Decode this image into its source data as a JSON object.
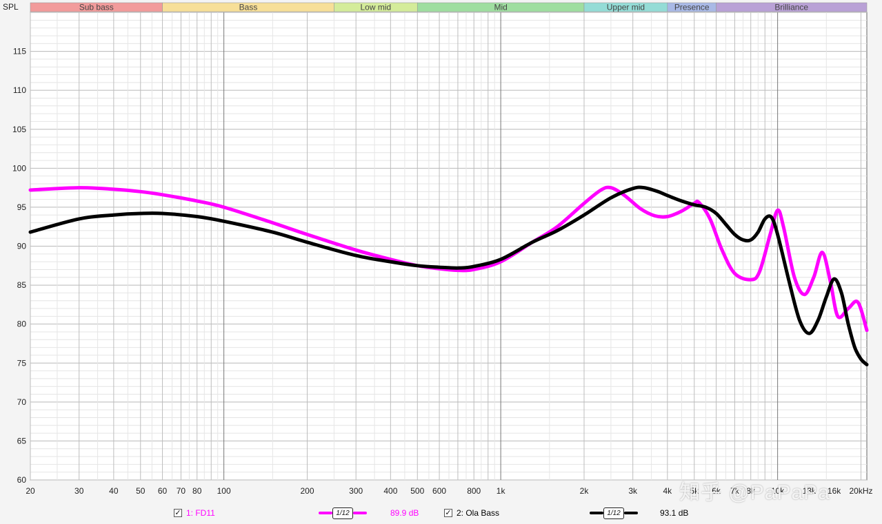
{
  "chart_data": {
    "type": "line",
    "title": "",
    "ylabel": "SPL",
    "xlabel": "",
    "x_scale": "log",
    "xlim": [
      20,
      21000
    ],
    "ylim": [
      60,
      120
    ],
    "grid": true,
    "y_ticks": [
      60,
      65,
      70,
      75,
      80,
      85,
      90,
      95,
      100,
      105,
      110,
      115
    ],
    "x_ticks": [
      {
        "v": 20,
        "label": "20"
      },
      {
        "v": 30,
        "label": "30"
      },
      {
        "v": 40,
        "label": "40"
      },
      {
        "v": 50,
        "label": "50"
      },
      {
        "v": 60,
        "label": "60"
      },
      {
        "v": 70,
        "label": "70"
      },
      {
        "v": 80,
        "label": "80"
      },
      {
        "v": 100,
        "label": "100"
      },
      {
        "v": 200,
        "label": "200"
      },
      {
        "v": 300,
        "label": "300"
      },
      {
        "v": 400,
        "label": "400"
      },
      {
        "v": 500,
        "label": "500"
      },
      {
        "v": 600,
        "label": "600"
      },
      {
        "v": 800,
        "label": "800"
      },
      {
        "v": 1000,
        "label": "1k"
      },
      {
        "v": 2000,
        "label": "2k"
      },
      {
        "v": 3000,
        "label": "3k"
      },
      {
        "v": 4000,
        "label": "4k"
      },
      {
        "v": 5000,
        "label": "5k"
      },
      {
        "v": 6000,
        "label": "6k"
      },
      {
        "v": 7000,
        "label": "7k"
      },
      {
        "v": 8000,
        "label": "8k"
      },
      {
        "v": 10000,
        "label": "10k"
      },
      {
        "v": 13000,
        "label": "13k"
      },
      {
        "v": 16000,
        "label": "16k"
      },
      {
        "v": 20000,
        "label": "20kHz"
      }
    ],
    "bands": [
      {
        "name": "Sub bass",
        "from": 20,
        "to": 60,
        "color": "#f29b9b"
      },
      {
        "name": "Bass",
        "from": 60,
        "to": 250,
        "color": "#f7df98"
      },
      {
        "name": "Low mid",
        "from": 250,
        "to": 500,
        "color": "#d4ec9a"
      },
      {
        "name": "Mid",
        "from": 500,
        "to": 2000,
        "color": "#9fdea0"
      },
      {
        "name": "Upper mid",
        "from": 2000,
        "to": 4000,
        "color": "#94dcd6"
      },
      {
        "name": "Presence",
        "from": 4000,
        "to": 6000,
        "color": "#a9b9e6"
      },
      {
        "name": "Brilliance",
        "from": 6000,
        "to": 21000,
        "color": "#b9a1d6"
      }
    ],
    "series": [
      {
        "name": "1: FD11",
        "color": "#ff00ff",
        "x": [
          20,
          30,
          40,
          50,
          60,
          80,
          100,
          150,
          200,
          300,
          400,
          500,
          600,
          700,
          800,
          1000,
          1300,
          1600,
          2000,
          2300,
          2500,
          2800,
          3200,
          3600,
          4000,
          4500,
          5000,
          5200,
          5700,
          6300,
          7000,
          8000,
          8600,
          9400,
          10000,
          10500,
          11500,
          12500,
          13500,
          14500,
          15500,
          16500,
          18000,
          19500,
          21000
        ],
        "values": [
          97.2,
          97.5,
          97.3,
          97.0,
          96.6,
          95.8,
          95.0,
          93.0,
          91.5,
          89.5,
          88.3,
          87.5,
          87.1,
          86.9,
          87.0,
          88.0,
          90.5,
          92.5,
          95.5,
          97.2,
          97.5,
          96.5,
          94.8,
          93.9,
          93.8,
          94.5,
          95.5,
          95.6,
          93.5,
          89.5,
          86.5,
          85.7,
          86.7,
          91.5,
          94.6,
          92.5,
          86.0,
          83.8,
          86.0,
          89.2,
          85.5,
          81.0,
          82.0,
          82.8,
          79.2
        ]
      },
      {
        "name": "2: Ola Bass",
        "color": "#000000",
        "x": [
          20,
          30,
          40,
          50,
          60,
          80,
          100,
          150,
          200,
          300,
          400,
          500,
          600,
          700,
          800,
          1000,
          1300,
          1600,
          2000,
          2500,
          3000,
          3300,
          3700,
          4000,
          4500,
          5000,
          5500,
          6000,
          6500,
          7000,
          7500,
          8000,
          8500,
          9000,
          9500,
          10000,
          11000,
          12000,
          13000,
          14000,
          15000,
          16000,
          17000,
          18000,
          19000,
          20000,
          21000
        ],
        "values": [
          91.8,
          93.5,
          94.0,
          94.2,
          94.2,
          93.8,
          93.2,
          91.8,
          90.5,
          88.8,
          88.0,
          87.5,
          87.3,
          87.2,
          87.4,
          88.3,
          90.5,
          92.0,
          94.0,
          96.2,
          97.4,
          97.5,
          97.0,
          96.5,
          95.8,
          95.3,
          95.0,
          94.2,
          92.8,
          91.5,
          90.8,
          90.8,
          91.8,
          93.5,
          93.7,
          91.5,
          85.5,
          80.5,
          78.8,
          80.5,
          83.5,
          85.8,
          84.0,
          80.0,
          77.0,
          75.5,
          74.8
        ]
      }
    ]
  },
  "legend": {
    "item1_label": "1: FD11",
    "item1_color": "#ff00ff",
    "item1_smoothing": "1/12",
    "item1_value": "89.9 dB",
    "item2_label": "2: Ola Bass",
    "item2_color": "#000000",
    "item2_smoothing": "1/12",
    "item2_value": "93.1 dB",
    "check": "✓"
  },
  "watermark": "知乎 @PaPaPa"
}
